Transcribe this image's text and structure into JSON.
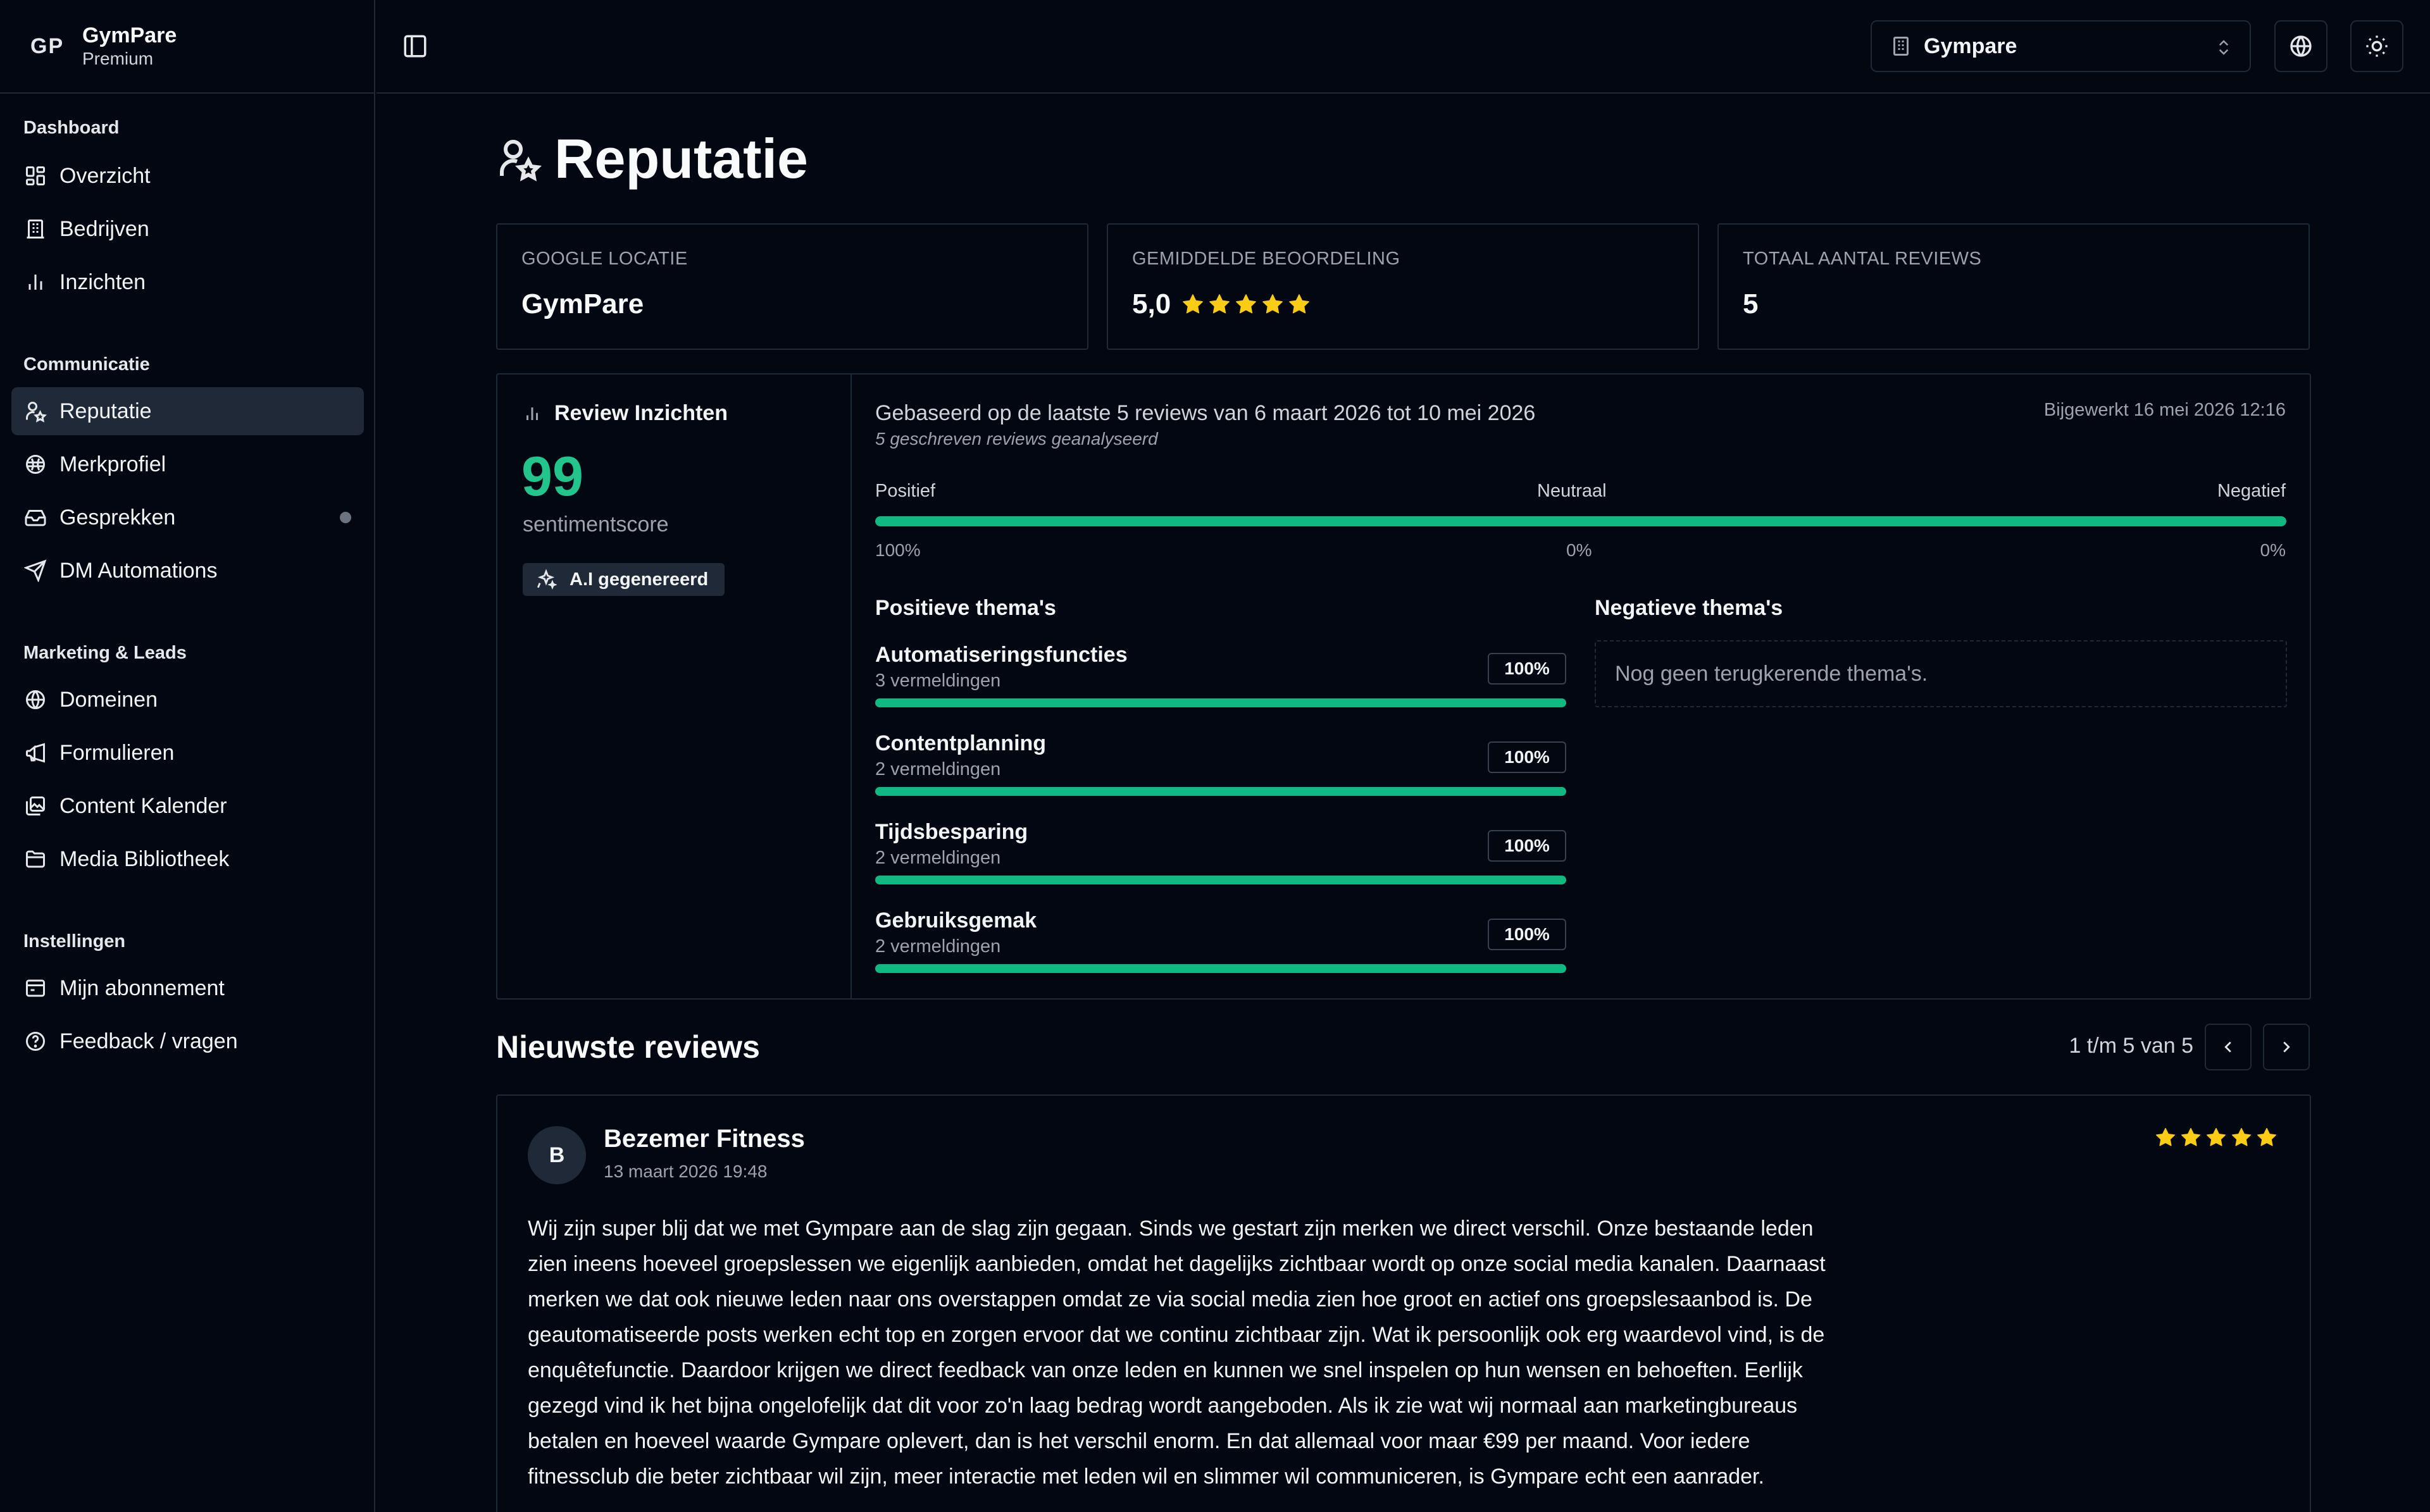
{
  "brand": {
    "logo": "GP",
    "name": "GymPare",
    "plan": "Premium"
  },
  "sidebar": {
    "groups": [
      {
        "label": "Dashboard",
        "items": [
          {
            "label": "Overzicht",
            "icon": "layout-dashboard-icon"
          },
          {
            "label": "Bedrijven",
            "icon": "building-icon"
          },
          {
            "label": "Inzichten",
            "icon": "bar-chart-icon"
          }
        ]
      },
      {
        "label": "Communicatie",
        "items": [
          {
            "label": "Reputatie",
            "icon": "user-star-icon",
            "active": true
          },
          {
            "label": "Merkprofiel",
            "icon": "brand-icon"
          },
          {
            "label": "Gesprekken",
            "icon": "inbox-icon",
            "has_dot": true
          },
          {
            "label": "DM Automations",
            "icon": "send-icon"
          }
        ]
      },
      {
        "label": "Marketing & Leads",
        "items": [
          {
            "label": "Domeinen",
            "icon": "globe-icon"
          },
          {
            "label": "Formulieren",
            "icon": "megaphone-icon"
          },
          {
            "label": "Content Kalender",
            "icon": "images-icon"
          },
          {
            "label": "Media Bibliotheek",
            "icon": "folder-icon"
          }
        ]
      },
      {
        "label": "Instellingen",
        "items": [
          {
            "label": "Mijn abonnement",
            "icon": "subscription-icon"
          },
          {
            "label": "Feedback / vragen",
            "icon": "help-circle-icon"
          }
        ]
      }
    ]
  },
  "topbar": {
    "company": "Gympare"
  },
  "page": {
    "title": "Reputatie"
  },
  "stats": {
    "location_label": "GOOGLE LOCATIE",
    "location_value": "GymPare",
    "rating_label": "GEMIDDELDE BEOORDELING",
    "rating_value": "5,0",
    "rating_stars": 5,
    "total_label": "TOTAAL AANTAL REVIEWS",
    "total_value": "5"
  },
  "insights": {
    "title": "Review Inzichten",
    "score": "99",
    "score_label": "sentimentscore",
    "ai_badge": "A.I gegenereerd",
    "description": "Gebaseerd op de laatste 5 reviews van 6 maart 2026 tot 10 mei 2026",
    "subdescription": "5 geschreven reviews geanalyseerd",
    "updated": "Bijgewerkt 16 mei 2026 12:16",
    "sentiment": {
      "positive_label": "Positief",
      "neutral_label": "Neutraal",
      "negative_label": "Negatief",
      "positive_pct": "100%",
      "neutral_pct": "0%",
      "negative_pct": "0%",
      "positive_fraction": 1.0
    },
    "positive_heading": "Positieve thema's",
    "negative_heading": "Negatieve thema's",
    "negative_empty": "Nog geen terugkerende thema's.",
    "themes": [
      {
        "name": "Automatiseringsfuncties",
        "count": "3 vermeldingen",
        "pct": "100%",
        "fraction": 1.0
      },
      {
        "name": "Contentplanning",
        "count": "2 vermeldingen",
        "pct": "100%",
        "fraction": 1.0
      },
      {
        "name": "Tijdsbesparing",
        "count": "2 vermeldingen",
        "pct": "100%",
        "fraction": 1.0
      },
      {
        "name": "Gebruiksgemak",
        "count": "2 vermeldingen",
        "pct": "100%",
        "fraction": 1.0
      }
    ]
  },
  "reviews": {
    "title": "Nieuwste reviews",
    "pager": "1 t/m 5 van 5",
    "items": [
      {
        "initial": "B",
        "name": "Bezemer Fitness",
        "date": "13 maart 2026 19:48",
        "stars": 5,
        "text": "Wij zijn super blij dat we met Gympare aan de slag zijn gegaan. Sinds we gestart zijn merken we direct verschil. Onze bestaande leden zien ineens hoeveel groepslessen we eigenlijk aanbieden, omdat het dagelijks zichtbaar wordt op onze social media kanalen. Daarnaast merken we dat ook nieuwe leden naar ons overstappen omdat ze via social media zien hoe groot en actief ons groepslesaanbod is. De geautomatiseerde posts werken echt top en zorgen ervoor dat we continu zichtbaar zijn. Wat ik persoonlijk ook erg waardevol vind, is de enquêtefunctie. Daardoor krijgen we direct feedback van onze leden en kunnen we snel inspelen op hun wensen en behoeften. Eerlijk gezegd vind ik het bijna ongelofelijk dat dit voor zo'n laag bedrag wordt aangeboden. Als ik zie wat wij normaal aan marketingbureaus betalen en hoeveel waarde Gympare oplevert, dan is het verschil enorm. En dat allemaal voor maar €99 per maand. Voor iedere fitnessclub die beter zichtbaar wil zijn, meer interactie met leden wil en slimmer wil communiceren, is Gympare echt een aanrader."
      }
    ]
  },
  "colors": {
    "accent_green": "#10b981",
    "score_green": "#22c58b",
    "star_yellow": "#facc15",
    "background": "#030712",
    "border": "#1f2937"
  }
}
